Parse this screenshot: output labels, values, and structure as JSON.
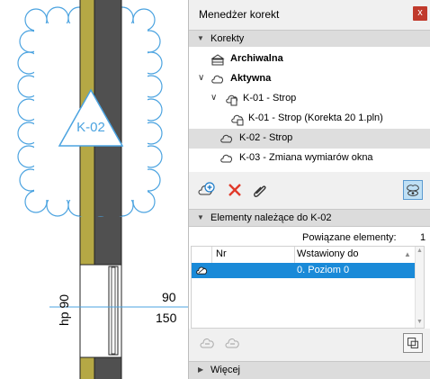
{
  "drawing": {
    "marker_label": "K-02",
    "dim_label_rot": "hp 90",
    "dim_upper": "90",
    "dim_lower": "150",
    "colors": {
      "cloud": "#4ba3e0",
      "wall_outer": "#b5a845",
      "wall_inner": "#505050"
    }
  },
  "panel": {
    "title": "Menedżer korekt",
    "close": "x",
    "sections": {
      "korekty": "Korekty",
      "elementy": "Elementy należące do K-02",
      "wiecej": "Więcej"
    },
    "tree": [
      {
        "label": "Archiwalna",
        "bold": true,
        "icon": "archive-icon"
      },
      {
        "label": "Aktywna",
        "bold": true,
        "icon": "cloud-icon"
      },
      {
        "label": "K-01 - Strop",
        "icon": "cloud-doc-icon"
      },
      {
        "label": "K-01 - Strop (Korekta 20 1.pln)",
        "icon": "cloud-lock-icon"
      },
      {
        "label": "K-02 - Strop",
        "icon": "cloud-icon",
        "selected": true
      },
      {
        "label": "K-03 - Zmiana wymiarów okna",
        "icon": "cloud-icon"
      }
    ],
    "related_label": "Powiązane elementy:",
    "related_count": "1",
    "table": {
      "columns": [
        "Nr",
        "Wstawiony do"
      ],
      "rows": [
        {
          "nr": "",
          "inserted": "0. Poziom 0"
        }
      ]
    },
    "colors": {
      "selection": "#1a8ad8",
      "close": "#c0392b",
      "delete": "#e03a2a"
    }
  }
}
